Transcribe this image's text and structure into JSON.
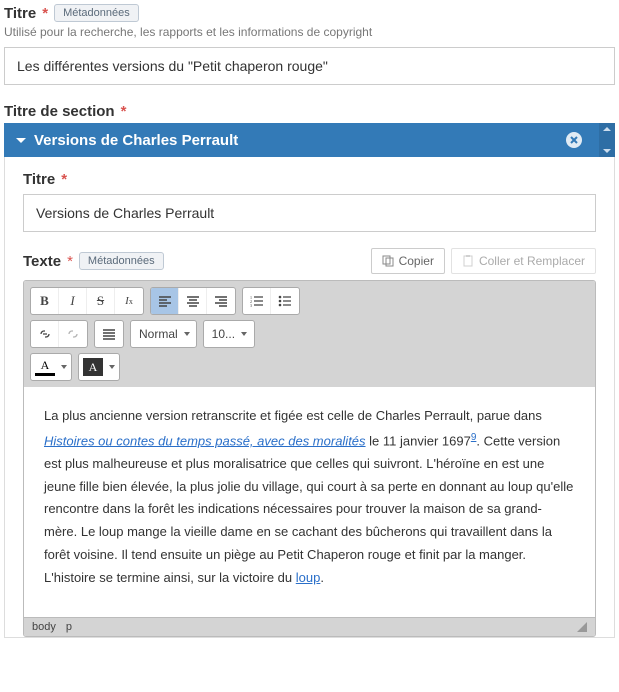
{
  "titre": {
    "label": "Titre",
    "meta_badge": "Métadonnées",
    "help": "Utilisé pour la recherche, les rapports et les informations de copyright",
    "value": "Les différentes versions du \"Petit chaperon rouge\""
  },
  "section_titre": {
    "label": "Titre de section"
  },
  "section": {
    "header": "Versions de Charles Perrault",
    "titre_label": "Titre",
    "titre_value": "Versions de Charles Perrault",
    "texte_label": "Texte",
    "meta_badge": "Métadonnées",
    "copy_btn": "Copier",
    "paste_btn": "Coller et Remplacer",
    "format_select": "Normal",
    "size_select": "10...",
    "content": {
      "pre1": "La plus ancienne version retranscrite et figée est celle de Charles Perrault, parue dans ",
      "link1": "Histoires ou contes du temps passé, avec des moralités",
      "mid1": " le 11 janvier 1697",
      "sup": "9",
      "mid2": ". Cette version est plus malheureuse et plus moralisatrice que celles qui suivront. L'héroïne en est une jeune fille bien élevée, la plus jolie du village, qui court à sa perte en donnant au loup qu'elle rencontre dans la forêt les indications nécessaires pour trouver la maison de sa grand-mère. Le loup mange la vieille dame en se cachant des bûcherons qui travaillent dans la forêt voisine. Il tend ensuite un piège au Petit Chaperon rouge et finit par la manger. L'histoire se termine ainsi, sur la victoire du ",
      "link2": "loup",
      "post": "."
    },
    "status_path": [
      "body",
      "p"
    ]
  }
}
